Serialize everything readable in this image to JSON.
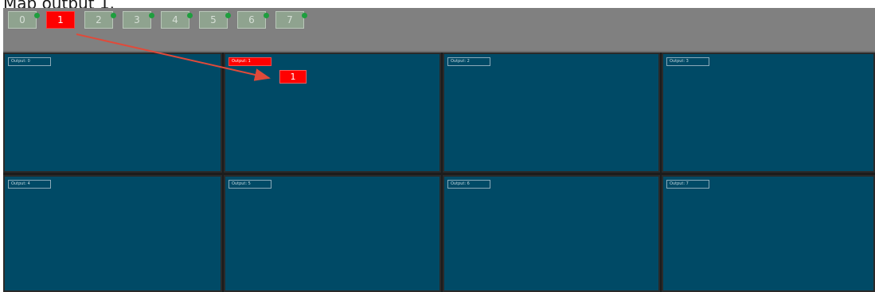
{
  "caption": "Map output 1.",
  "inputs": [
    {
      "label": "0",
      "selected": false
    },
    {
      "label": "1",
      "selected": true
    },
    {
      "label": "2",
      "selected": false
    },
    {
      "label": "3",
      "selected": false
    },
    {
      "label": "4",
      "selected": false
    },
    {
      "label": "5",
      "selected": false
    },
    {
      "label": "6",
      "selected": false
    },
    {
      "label": "7",
      "selected": false
    }
  ],
  "outputs": [
    {
      "label": "Output: 0",
      "mapped": false
    },
    {
      "label": "Output: 1",
      "mapped": true
    },
    {
      "label": "Output: 2",
      "mapped": false
    },
    {
      "label": "Output: 3",
      "mapped": false
    },
    {
      "label": "Output: 4",
      "mapped": false
    },
    {
      "label": "Output: 5",
      "mapped": false
    },
    {
      "label": "Output: 6",
      "mapped": false
    },
    {
      "label": "Output: 7",
      "mapped": false
    }
  ],
  "drag_chip": {
    "label": "1"
  },
  "colors": {
    "selected": "#ff0000",
    "output_bg": "#004a66",
    "toolbar_bg": "#808080",
    "status_ok": "#1e9e3e",
    "arrow": "#e04a3a"
  }
}
